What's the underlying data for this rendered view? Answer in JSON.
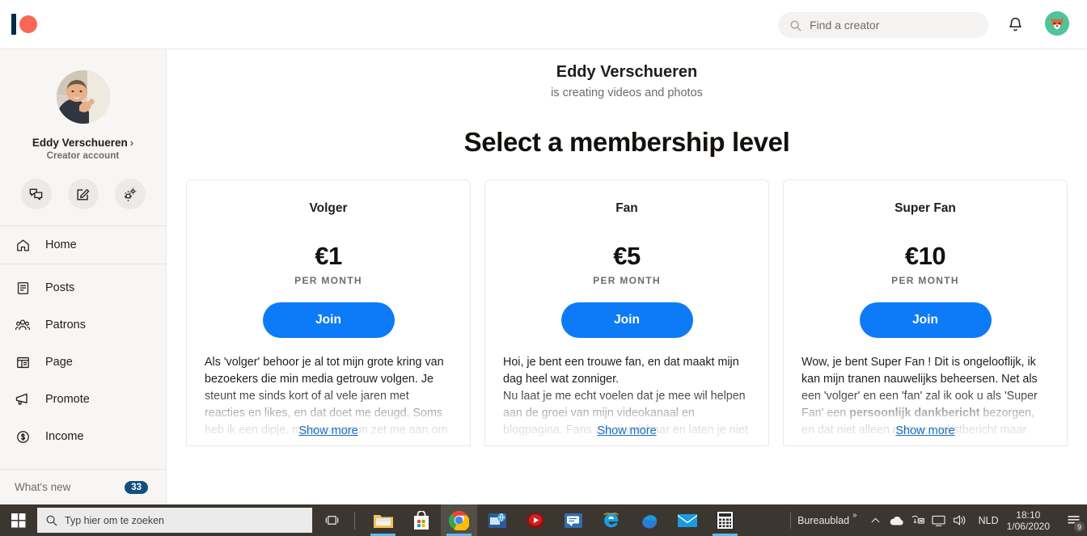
{
  "header": {
    "logo_name": "patreon-logo",
    "logo_bar_color": "#052a49",
    "logo_dot_color": "#f96854",
    "search": {
      "placeholder": "Find a creator",
      "value": "",
      "icon": "search-icon"
    },
    "bell_icon": "notification-bell-icon",
    "avatar_icon": "fox-avatar",
    "avatar_bg": "#4ec49a"
  },
  "sidebar": {
    "profile": {
      "name": "Eddy Verschueren",
      "chevron": "›",
      "subtitle": "Creator account"
    },
    "actions": [
      {
        "name": "messages-button",
        "icon": "chat-bubbles-icon"
      },
      {
        "name": "create-post-button",
        "icon": "edit-pencil-icon"
      },
      {
        "name": "settings-button",
        "icon": "gears-icon"
      }
    ],
    "nav": [
      {
        "label": "Home",
        "icon": "home-icon",
        "name": "sidebar-item-home"
      },
      {
        "label": "Posts",
        "icon": "posts-icon",
        "name": "sidebar-item-posts"
      },
      {
        "label": "Patrons",
        "icon": "patrons-icon",
        "name": "sidebar-item-patrons"
      },
      {
        "label": "Page",
        "icon": "page-icon",
        "name": "sidebar-item-page"
      },
      {
        "label": "Promote",
        "icon": "megaphone-icon",
        "name": "sidebar-item-promote"
      },
      {
        "label": "Income",
        "icon": "dollar-circle-icon",
        "name": "sidebar-item-income"
      }
    ],
    "whats_new": {
      "label": "What's new",
      "badge": "33",
      "badge_color": "#14507d"
    }
  },
  "main": {
    "creator_name": "Eddy Verschueren",
    "creator_tagline": "is creating videos and photos",
    "page_title": "Select a membership level",
    "join_color": "#0d7bf7",
    "show_more_label": "Show more",
    "tiers": [
      {
        "name": "Volger",
        "price": "€1",
        "period": "PER MONTH",
        "join_label": "Join",
        "description": "Als 'volger' behoor je al tot mijn grote kring van bezoekers die min media getrouw volgen. Je steunt me sinds kort of al vele jaren met reacties en likes, en dat doet me deugd. Soms heb ik een dipje, maar uw steun zet me aan om"
      },
      {
        "name": "Fan",
        "price": "€5",
        "period": "PER MONTH",
        "join_label": "Join",
        "description": "Hoi, je bent een trouwe fan, en dat maakt mijn dag heel wat zonniger.\nNu laat je me echt voelen dat je mee wil helpen aan de groei van mijn videokanaal en blogpagina. Fans zijn onmisbaar en laten je niet snel in de steek en dat voelt"
      },
      {
        "name": "Super Fan",
        "price": "€10",
        "period": "PER MONTH",
        "join_label": "Join",
        "description_part1": "Wow, je bent Super Fan ! Dit is ongelooflijk, ik kan mijn tranen nauwelijks beheersen. Net als een 'volger' en een 'fan' zal ik ook u als 'Super Fan' een ",
        "description_bold": "persoonlijk dankbericht",
        "description_part2": " bezorgen, en dat niet alleen met een tekstbericht maar"
      }
    ]
  },
  "taskbar": {
    "start_icon": "windows-start-icon",
    "search": {
      "placeholder": "Typ hier om te zoeken",
      "icon": "search-icon"
    },
    "task_view_icon": "task-view-icon",
    "apps": [
      {
        "name": "file-explorer",
        "icon": "folder-icon"
      },
      {
        "name": "microsoft-store",
        "icon": "store-bag-icon"
      },
      {
        "name": "google-chrome",
        "icon": "chrome-icon"
      },
      {
        "name": "remote-desktop",
        "icon": "monitor-globe-icon"
      },
      {
        "name": "media-player",
        "icon": "red-disc-icon"
      },
      {
        "name": "messaging-app",
        "icon": "chat-window-icon"
      },
      {
        "name": "internet-explorer",
        "icon": "ie-icon"
      },
      {
        "name": "microsoft-edge",
        "icon": "edge-icon"
      },
      {
        "name": "mail",
        "icon": "envelope-icon"
      },
      {
        "name": "calculator",
        "icon": "calculator-icon"
      }
    ],
    "tray": {
      "desktop_label": "Bureaublad",
      "overflow": "»",
      "chevron_icon": "show-hidden-icons-icon",
      "onedrive_icon": "cloud-icon",
      "network_icon": "network-unavailable-icon",
      "display_icon": "display-icon",
      "volume_icon": "speaker-icon",
      "language": "NLD",
      "time": "18:10",
      "date": "1/06/2020",
      "notification_icon": "action-center-icon",
      "notification_count": "9"
    }
  }
}
